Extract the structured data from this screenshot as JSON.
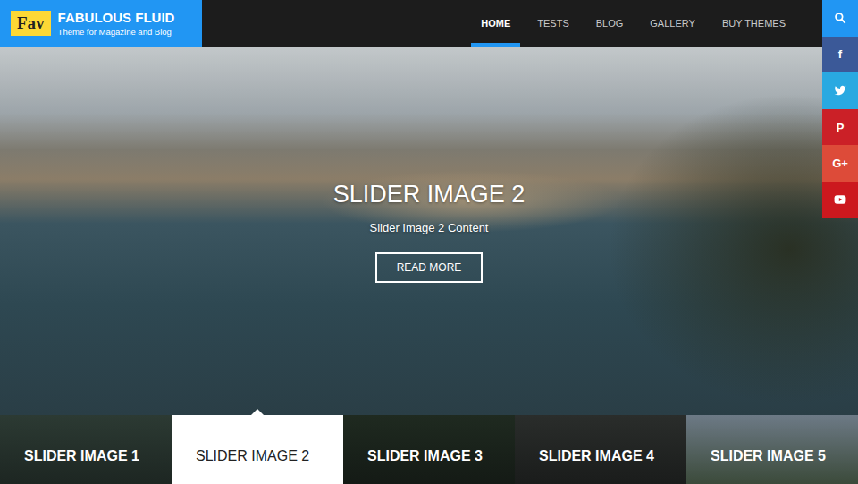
{
  "logo": {
    "badge": "Fav",
    "title": "FABULOUS FLUID",
    "tagline": "Theme for Magazine and Blog"
  },
  "nav": [
    {
      "label": "HOME",
      "selected": true
    },
    {
      "label": "TESTS",
      "selected": false
    },
    {
      "label": "BLOG",
      "selected": false
    },
    {
      "label": "GALLERY",
      "selected": false
    },
    {
      "label": "BUY THEMES",
      "selected": false
    }
  ],
  "social": [
    {
      "kind": "svg",
      "color": "#2196f3"
    },
    {
      "kind": "glyph",
      "glyph": "f",
      "color": "#3b5998"
    },
    {
      "kind": "svg",
      "color": "#29a9e1"
    },
    {
      "kind": "glyph",
      "glyph": "P",
      "color": "#cb2027"
    },
    {
      "kind": "glyph",
      "glyph": "G+",
      "color": "#dd4b39"
    },
    {
      "kind": "svg",
      "color": "#cc181e"
    }
  ],
  "hero": {
    "title": "SLIDER IMAGE 2",
    "content": "Slider Image 2 Content",
    "button": "READ MORE"
  },
  "slides": [
    {
      "label": "SLIDER IMAGE 1",
      "selected": false
    },
    {
      "label": "SLIDER IMAGE 2",
      "selected": true
    },
    {
      "label": "SLIDER IMAGE 3",
      "selected": false
    },
    {
      "label": "SLIDER IMAGE 4",
      "selected": false
    },
    {
      "label": "SLIDER IMAGE 5",
      "selected": false
    }
  ]
}
